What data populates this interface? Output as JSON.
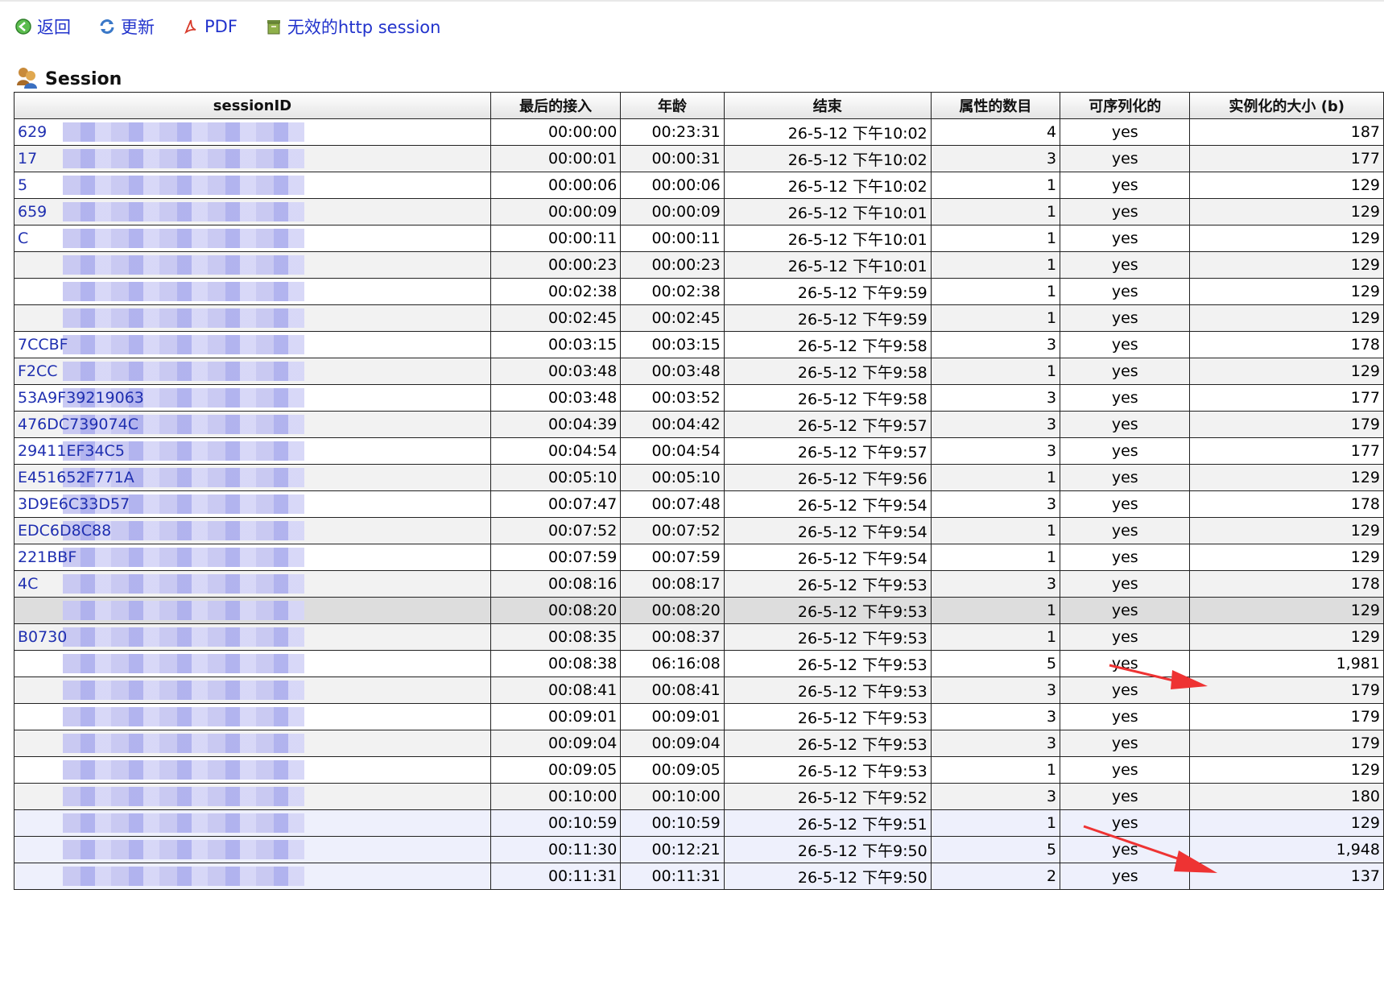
{
  "toolbar": [
    {
      "name": "back-button",
      "icon": "back-icon",
      "label": "返回"
    },
    {
      "name": "refresh-button",
      "icon": "refresh-icon",
      "label": "更新"
    },
    {
      "name": "pdf-button",
      "icon": "pdf-icon",
      "label": "PDF"
    },
    {
      "name": "invalidate-sessions-button",
      "icon": "trash-icon",
      "label": "无效的http session"
    }
  ],
  "section": {
    "title": "Session",
    "icon": "users-icon"
  },
  "table": {
    "headers": [
      "sessionID",
      "最后的接入",
      "年龄",
      "结束",
      "属性的数目",
      "可序列化的",
      "实例化的大小 (b)"
    ],
    "rows": [
      [
        "629",
        "00:00:00",
        "00:23:31",
        "26-5-12 下午10:02",
        "4",
        "yes",
        "187"
      ],
      [
        "17",
        "00:00:01",
        "00:00:31",
        "26-5-12 下午10:02",
        "3",
        "yes",
        "177"
      ],
      [
        "5",
        "00:00:06",
        "00:00:06",
        "26-5-12 下午10:02",
        "1",
        "yes",
        "129"
      ],
      [
        "659",
        "00:00:09",
        "00:00:09",
        "26-5-12 下午10:01",
        "1",
        "yes",
        "129"
      ],
      [
        "C",
        "00:00:11",
        "00:00:11",
        "26-5-12 下午10:01",
        "1",
        "yes",
        "129"
      ],
      [
        "",
        "00:00:23",
        "00:00:23",
        "26-5-12 下午10:01",
        "1",
        "yes",
        "129"
      ],
      [
        "",
        "00:02:38",
        "00:02:38",
        "26-5-12 下午9:59",
        "1",
        "yes",
        "129"
      ],
      [
        "",
        "00:02:45",
        "00:02:45",
        "26-5-12 下午9:59",
        "1",
        "yes",
        "129"
      ],
      [
        "7CCBF",
        "00:03:15",
        "00:03:15",
        "26-5-12 下午9:58",
        "3",
        "yes",
        "178"
      ],
      [
        "F2CC",
        "00:03:48",
        "00:03:48",
        "26-5-12 下午9:58",
        "1",
        "yes",
        "129"
      ],
      [
        "53A9F39219063",
        "00:03:48",
        "00:03:52",
        "26-5-12 下午9:58",
        "3",
        "yes",
        "177"
      ],
      [
        "476DC739074C",
        "00:04:39",
        "00:04:42",
        "26-5-12 下午9:57",
        "3",
        "yes",
        "179"
      ],
      [
        "29411EF34C5",
        "00:04:54",
        "00:04:54",
        "26-5-12 下午9:57",
        "3",
        "yes",
        "177"
      ],
      [
        "E451652F771A",
        "00:05:10",
        "00:05:10",
        "26-5-12 下午9:56",
        "1",
        "yes",
        "129"
      ],
      [
        "3D9E6C33D57",
        "00:07:47",
        "00:07:48",
        "26-5-12 下午9:54",
        "3",
        "yes",
        "178"
      ],
      [
        "EDC6D8C88",
        "00:07:52",
        "00:07:52",
        "26-5-12 下午9:54",
        "1",
        "yes",
        "129"
      ],
      [
        "221BBF",
        "00:07:59",
        "00:07:59",
        "26-5-12 下午9:54",
        "1",
        "yes",
        "129"
      ],
      [
        "4C",
        "00:08:16",
        "00:08:17",
        "26-5-12 下午9:53",
        "3",
        "yes",
        "178"
      ],
      [
        "",
        "00:08:20",
        "00:08:20",
        "26-5-12 下午9:53",
        "1",
        "yes",
        "129"
      ],
      [
        "B0730",
        "00:08:35",
        "00:08:37",
        "26-5-12 下午9:53",
        "1",
        "yes",
        "129"
      ],
      [
        "",
        "00:08:38",
        "06:16:08",
        "26-5-12 下午9:53",
        "5",
        "yes",
        "1,981"
      ],
      [
        "",
        "00:08:41",
        "00:08:41",
        "26-5-12 下午9:53",
        "3",
        "yes",
        "179"
      ],
      [
        "",
        "00:09:01",
        "00:09:01",
        "26-5-12 下午9:53",
        "3",
        "yes",
        "179"
      ],
      [
        "",
        "00:09:04",
        "00:09:04",
        "26-5-12 下午9:53",
        "3",
        "yes",
        "179"
      ],
      [
        "",
        "00:09:05",
        "00:09:05",
        "26-5-12 下午9:53",
        "1",
        "yes",
        "129"
      ],
      [
        "",
        "00:10:00",
        "00:10:00",
        "26-5-12 下午9:52",
        "3",
        "yes",
        "180"
      ],
      [
        "",
        "00:10:59",
        "00:10:59",
        "26-5-12 下午9:51",
        "1",
        "yes",
        "129"
      ],
      [
        "",
        "00:11:30",
        "00:12:21",
        "26-5-12 下午9:50",
        "5",
        "yes",
        "1,948"
      ],
      [
        "",
        "00:11:31",
        "00:11:31",
        "26-5-12 下午9:50",
        "2",
        "yes",
        "137"
      ]
    ]
  },
  "colors": {
    "link": "#1f2fb0",
    "arrow": "#ee3333",
    "border": "#222222"
  }
}
